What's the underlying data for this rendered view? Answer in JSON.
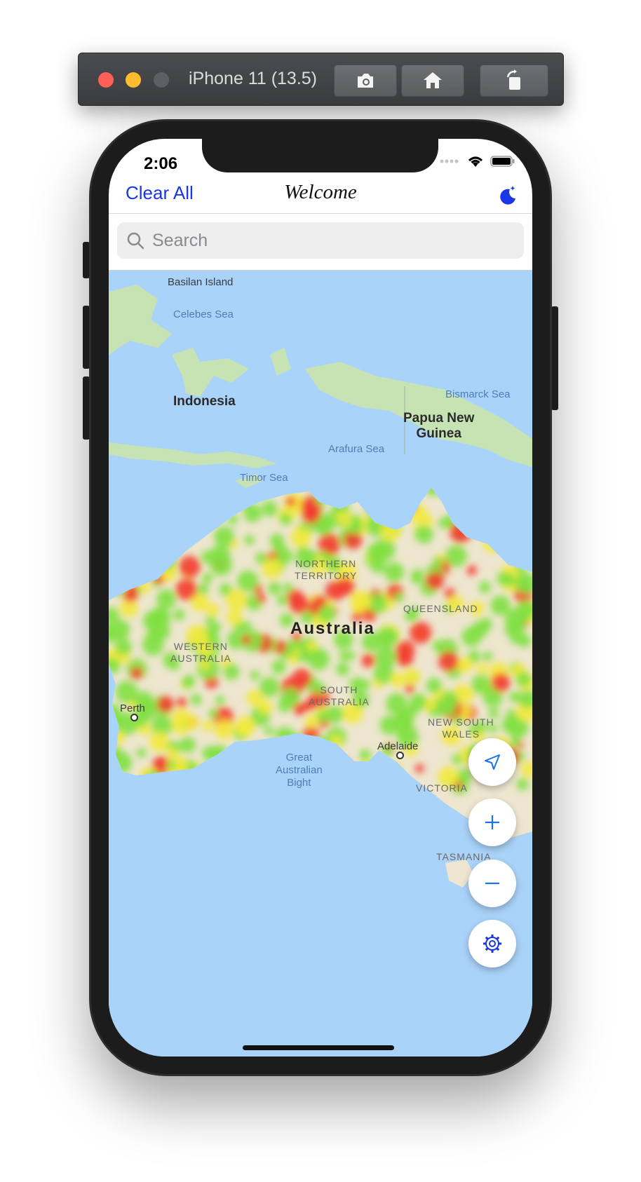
{
  "simulator": {
    "title": "iPhone 11 (13.5)",
    "buttons": [
      "screenshot-icon",
      "home-icon",
      "rotate-icon"
    ]
  },
  "status_bar": {
    "time": "2:06"
  },
  "nav": {
    "left_button": "Clear All",
    "title": "Welcome",
    "right_icon": "moon-icon"
  },
  "search": {
    "placeholder": "Search",
    "value": ""
  },
  "map": {
    "labels": {
      "basilan": "Basilan Island",
      "celebes": "Celebes Sea",
      "indonesia": "Indonesia",
      "bismarck": "Bismarck Sea",
      "png_line1": "Papua New",
      "png_line2": "Guinea",
      "arafura": "Arafura Sea",
      "timor": "Timor Sea",
      "nt_line1": "NORTHERN",
      "nt_line2": "TERRITORY",
      "qld": "QUEENSLAND",
      "australia": "Australia",
      "wa_line1": "WESTERN",
      "wa_line2": "AUSTRALIA",
      "sa_line1": "SOUTH",
      "sa_line2": "AUSTRALIA",
      "perth": "Perth",
      "nsw_line1": "NEW SOUTH",
      "nsw_line2": "WALES",
      "gab_line1": "Great",
      "gab_line2": "Australian",
      "gab_line3": "Bight",
      "adelaide": "Adelaide",
      "victoria": "VICTORIA",
      "tasmania": "TASMANIA"
    },
    "layer": "heatmap",
    "colors": {
      "ocean": "#aad3f9",
      "land": "#eee6cf",
      "vegetation": "#c7e3b4",
      "heat_low": "#7fe040",
      "heat_mid": "#f2e93a",
      "heat_high": "#f23a2f",
      "accent": "#1a37e5"
    }
  },
  "controls": [
    "location-arrow-icon",
    "zoom-in-icon",
    "zoom-out-icon",
    "settings-icon"
  ]
}
